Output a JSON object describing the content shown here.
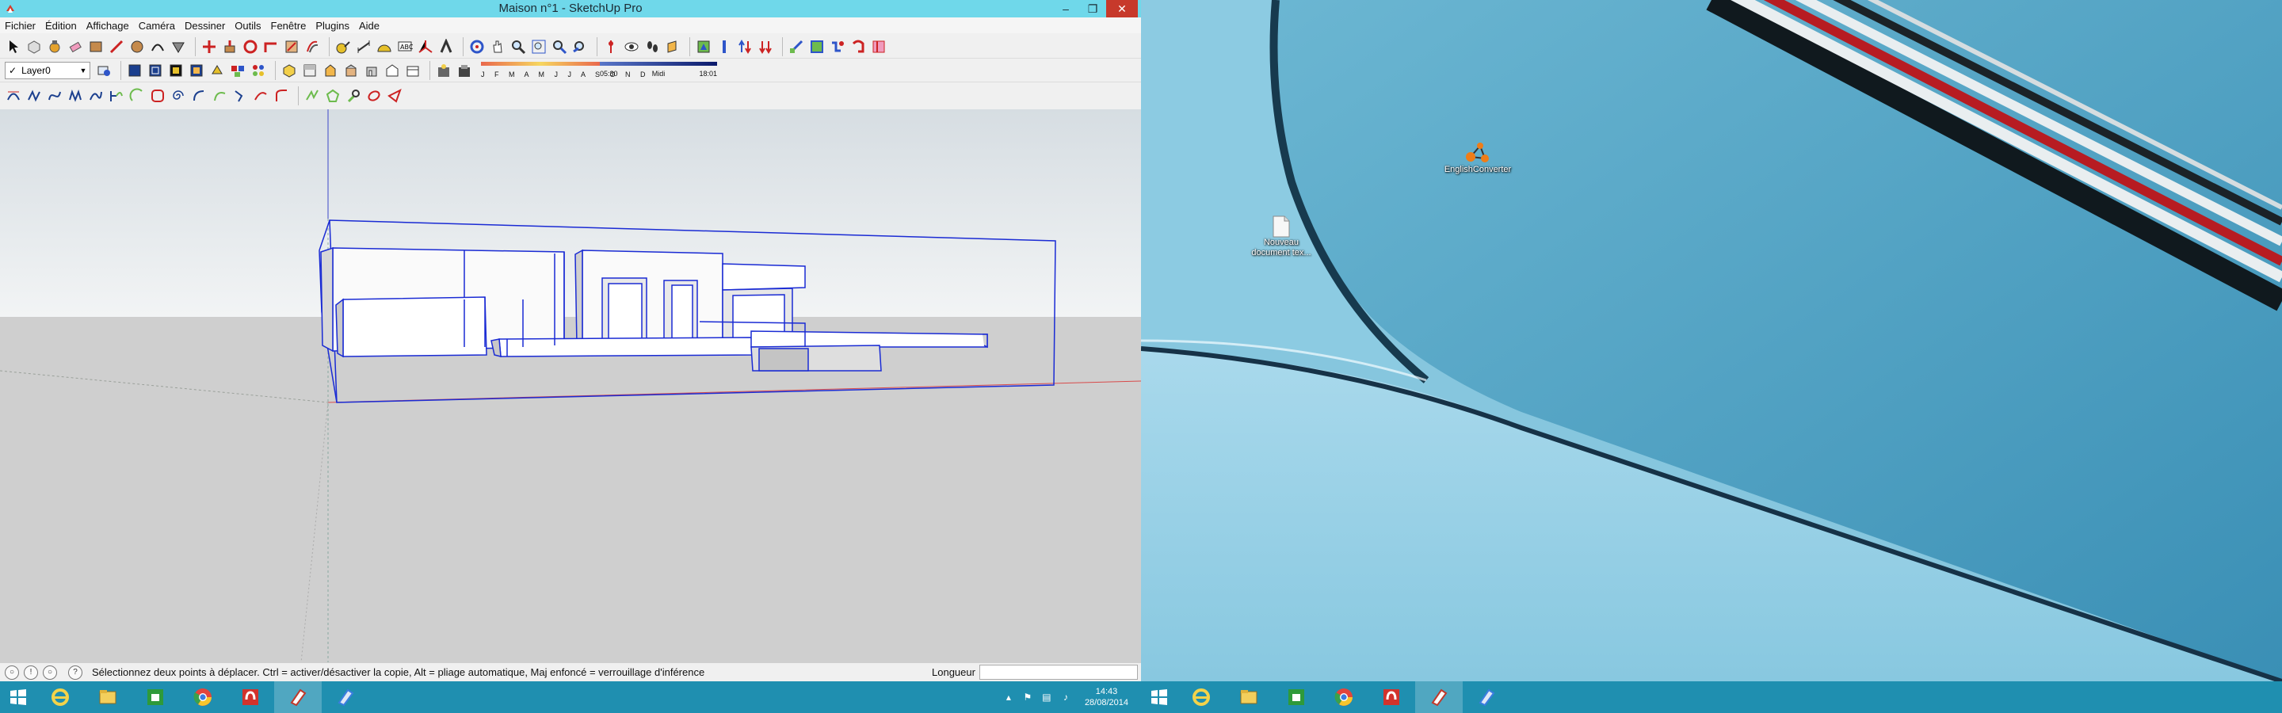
{
  "window": {
    "title": "Maison n°1 - SketchUp Pro",
    "minimize": "–",
    "restore": "❐",
    "close": "✕"
  },
  "menu": [
    "Fichier",
    "Édition",
    "Affichage",
    "Caméra",
    "Dessiner",
    "Outils",
    "Fenêtre",
    "Plugins",
    "Aide"
  ],
  "layer": {
    "checked": "✓",
    "name": "Layer0",
    "arrow": "▼"
  },
  "shadow": {
    "months": "J F M A M J J A S O N D",
    "time_start": "05:30",
    "time_mid": "Midi",
    "time_end": "18:01"
  },
  "status": {
    "message": "Sélectionnez deux points à déplacer.  Ctrl = activer/désactiver la copie, Alt = pliage automatique, Maj enfoncé = verrouillage d'inférence",
    "measure_label": "Longueur",
    "measure_value": ""
  },
  "taskbar": {
    "apps": [
      "start-icon",
      "internet-explorer-icon",
      "file-explorer-icon",
      "store-icon",
      "chrome-icon",
      "music-icon",
      "sketchup-icon",
      "layout-icon"
    ],
    "clock_time": "14:43",
    "clock_date": "28/08/2014"
  },
  "desktop": {
    "icons": [
      {
        "name": "shortcut-app-icon",
        "label": "EnglishConverter"
      },
      {
        "name": "text-document-icon",
        "label": "Nouveau document tex..."
      }
    ]
  },
  "colors": {
    "titlebar": "#6fd8ea",
    "taskbar": "#1f8fb0",
    "model_edges": "#1a2bd4",
    "wallpaper": "#7cc0d9"
  }
}
